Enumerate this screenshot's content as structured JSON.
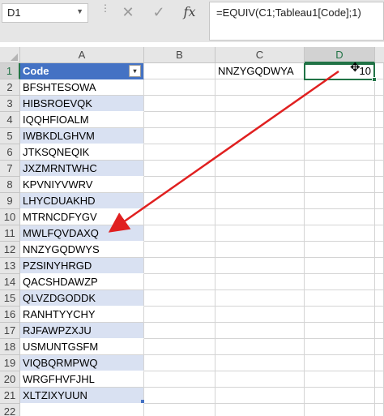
{
  "name_box": {
    "value": "D1"
  },
  "formula_bar": {
    "cancel_icon": "close-icon",
    "enter_icon": "check-icon",
    "fx_label": "fx",
    "formula": "=EQUIV(C1;Tableau1[Code];1)"
  },
  "columns": [
    "A",
    "B",
    "C",
    "D"
  ],
  "rows": [
    "1",
    "2",
    "3",
    "4",
    "5",
    "6",
    "7",
    "8",
    "9",
    "10",
    "11",
    "12",
    "13",
    "14",
    "15",
    "16",
    "17",
    "18",
    "19",
    "20",
    "21",
    "22"
  ],
  "table": {
    "header": "Code",
    "codes": [
      "BFSHTESOWA",
      "HIBSROEVQK",
      "IQQHFIOALM",
      "IWBKDLGHVM",
      "JTKSQNEQIK",
      "JXZMRNTWHC",
      "KPVNIYVWRV",
      "LHYCDUAKHD",
      "MTRNCDFYGV",
      "MWLFQVDAXQ",
      "NNZYGQDWYS",
      "PZSINYHRGD",
      "QACSHDAWZP",
      "QLVZDGODDK",
      "RANHTYYCHY",
      "RJFAWPZXJU",
      "USMUNTGSFM",
      "VIQBQRMPWQ",
      "WRGFHVFJHL",
      "XLTZIXYUUN"
    ]
  },
  "cells": {
    "C1": "NNZYGQDWYA",
    "D1": "10"
  },
  "colors": {
    "table_header": "#4472c4",
    "band": "#d9e1f2",
    "selection": "#217346",
    "arrow": "#e02020"
  }
}
